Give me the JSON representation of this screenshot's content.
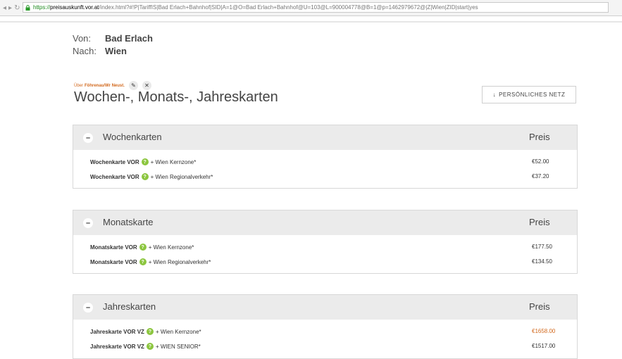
{
  "browser": {
    "url_scheme": "https://",
    "url_host": "preisauskunft.vor.at",
    "url_rest": "/index.html?#!P|TariffIS|Bad Erlach+Bahnhof|SID|A=1@O=Bad Erlach+Bahnhof@U=103@L=900004778@B=1@p=1462979672@|Z|Wien|ZID|start|yes"
  },
  "route": {
    "von_label": "Von:",
    "von_value": "Bad Erlach",
    "nach_label": "Nach:",
    "nach_value": "Wien"
  },
  "via": {
    "label": "Über",
    "value": "Föhrenau/Wr Neust."
  },
  "page_title": "Wochen-, Monats-, Jahreskarten",
  "netz_button": "PERSÖNLICHES NETZ",
  "sections": [
    {
      "title": "Wochenkarten",
      "price_header": "Preis",
      "rows": [
        {
          "name": "Wochenkarte VOR",
          "suffix": "+ Wien Kernzone*",
          "price": "€52.00"
        },
        {
          "name": "Wochenkarte VOR",
          "suffix": "+ Wien Regionalverkehr*",
          "price": "€37.20"
        }
      ]
    },
    {
      "title": "Monatskarte",
      "price_header": "Preis",
      "rows": [
        {
          "name": "Monatskarte VOR",
          "suffix": "+ Wien Kernzone*",
          "price": "€177.50"
        },
        {
          "name": "Monatskarte VOR",
          "suffix": "+ Wien Regionalverkehr*",
          "price": "€134.50"
        }
      ]
    },
    {
      "title": "Jahreskarten",
      "price_header": "Preis",
      "rows": [
        {
          "name": "Jahreskarte VOR VZ",
          "suffix": "+ Wien Kernzone*",
          "price": "€1658.00"
        },
        {
          "name": "Jahreskarte VOR VZ",
          "suffix": "+ WIEN SENIOR*",
          "price": "€1517.00"
        }
      ]
    }
  ],
  "icons": {
    "help": "question-icon",
    "collapse": "minus-icon",
    "edit": "pencil-icon",
    "remove": "close-icon",
    "netz": "arrow-down-icon"
  },
  "colors": {
    "accent": "#d2691e",
    "help_green": "#8cc63f",
    "section_header_bg": "#ebebeb"
  }
}
